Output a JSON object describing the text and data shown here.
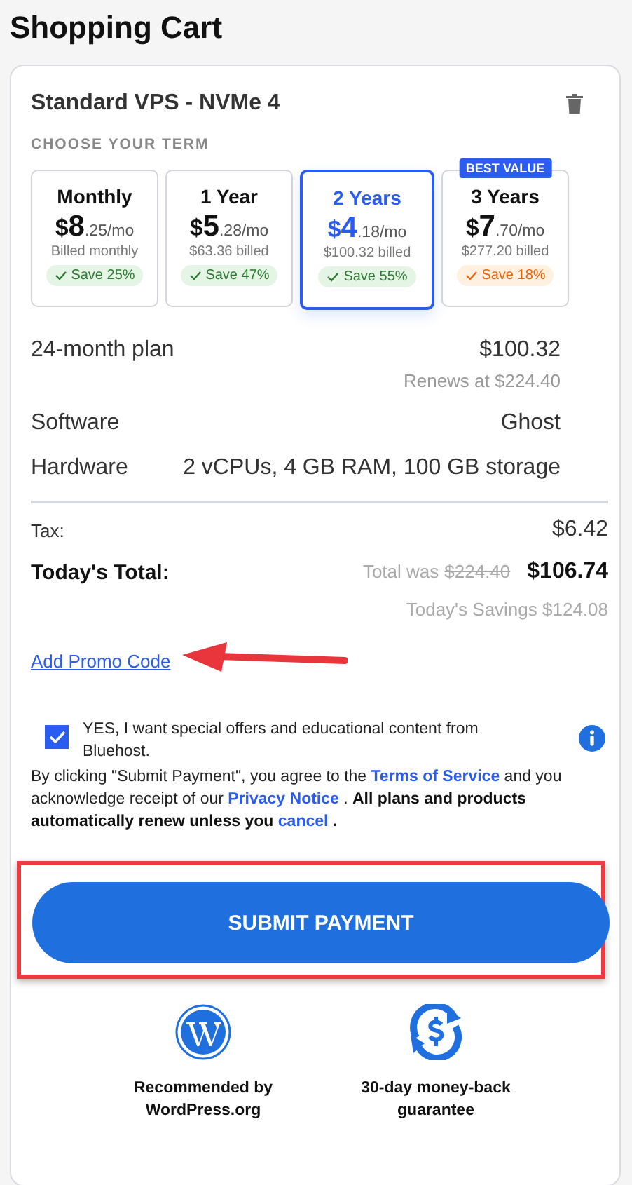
{
  "page_title": "Shopping Cart",
  "product": {
    "name": "Standard VPS - NVMe 4"
  },
  "term_heading": "CHOOSE YOUR TERM",
  "terms": [
    {
      "label": "Monthly",
      "currency": "$",
      "whole": "8",
      "fraction": ".25/mo",
      "billed": "Billed monthly",
      "save": "Save 25%",
      "kind": "good",
      "selected": false
    },
    {
      "label": "1 Year",
      "currency": "$",
      "whole": "5",
      "fraction": ".28/mo",
      "billed": "$63.36 billed",
      "save": "Save 47%",
      "kind": "good",
      "selected": false
    },
    {
      "label": "2 Years",
      "currency": "$",
      "whole": "4",
      "fraction": ".18/mo",
      "billed": "$100.32 billed",
      "save": "Save 55%",
      "kind": "good",
      "selected": true
    },
    {
      "label": "3 Years",
      "currency": "$",
      "whole": "7",
      "fraction": ".70/mo",
      "billed": "$277.20 billed",
      "save": "Save 18%",
      "kind": "warn",
      "selected": false,
      "badge": "BEST VALUE"
    }
  ],
  "details": [
    {
      "label": "24-month plan",
      "value": "$100.32",
      "note": "Renews at $224.40"
    },
    {
      "label": "Software",
      "value": "Ghost"
    },
    {
      "label": "Hardware",
      "value": "2 vCPUs, 4 GB RAM, 100 GB storage"
    }
  ],
  "tax": {
    "label": "Tax:",
    "value": "$6.42"
  },
  "total": {
    "label": "Today's Total:",
    "was_label": "Total was",
    "was_amount": "$224.40",
    "value": "$106.74",
    "savings": "Today's Savings $124.08"
  },
  "promo": {
    "label": "Add Promo Code",
    "arrow": true
  },
  "consent": {
    "checked": true,
    "text": "YES, I want special offers and educational content from Bluehost."
  },
  "legal": [
    {
      "kind": "plain",
      "text": " By clicking \"Submit Payment\", you agree to the "
    },
    {
      "kind": "link",
      "text": "Terms of Service"
    },
    {
      "kind": "plain",
      "text": " and you acknowledge receipt of our "
    },
    {
      "kind": "link",
      "text": "Privacy Notice"
    },
    {
      "kind": "plain",
      "text": " .  "
    },
    {
      "kind": "bold",
      "text": "All plans and products automatically renew unless you "
    },
    {
      "kind": "link",
      "text": "cancel"
    },
    {
      "kind": "bold",
      "text": " ."
    }
  ],
  "submit": {
    "label": "SUBMIT PAYMENT",
    "highlighted": true
  },
  "assurances": [
    {
      "kind": "wordpress",
      "text": "Recommended by WordPress.org"
    },
    {
      "kind": "money",
      "text": "30-day money-back guarantee"
    }
  ]
}
